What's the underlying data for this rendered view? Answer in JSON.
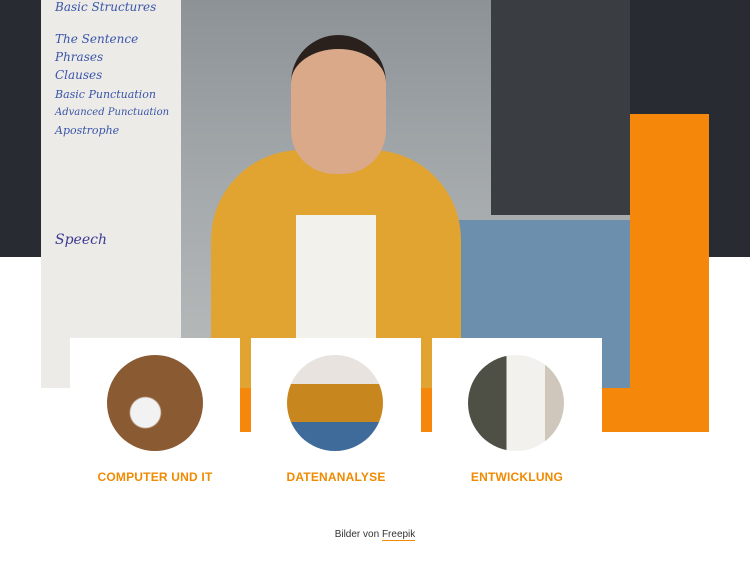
{
  "hero": {
    "whiteboard_lines": [
      "Basic Structures",
      "The Sentence",
      "Phrases",
      "Clauses",
      "Basic Punctuation",
      "Advanced Punctuation",
      "Apostrophe",
      "Speech"
    ]
  },
  "categories": [
    {
      "label": "COMPUTER UND IT",
      "image": "desk-with-notebook-headphones"
    },
    {
      "label": "DATENANALYSE",
      "image": "woman-with-headphones-laptop"
    },
    {
      "label": "ENTWICKLUNG",
      "image": "smiling-man-white-shirt"
    }
  ],
  "credit": {
    "prefix": "Bilder von",
    "link": "Freepik"
  },
  "colors": {
    "accent": "#f5870a",
    "dark": "#282b31",
    "label": "#f08a00"
  }
}
